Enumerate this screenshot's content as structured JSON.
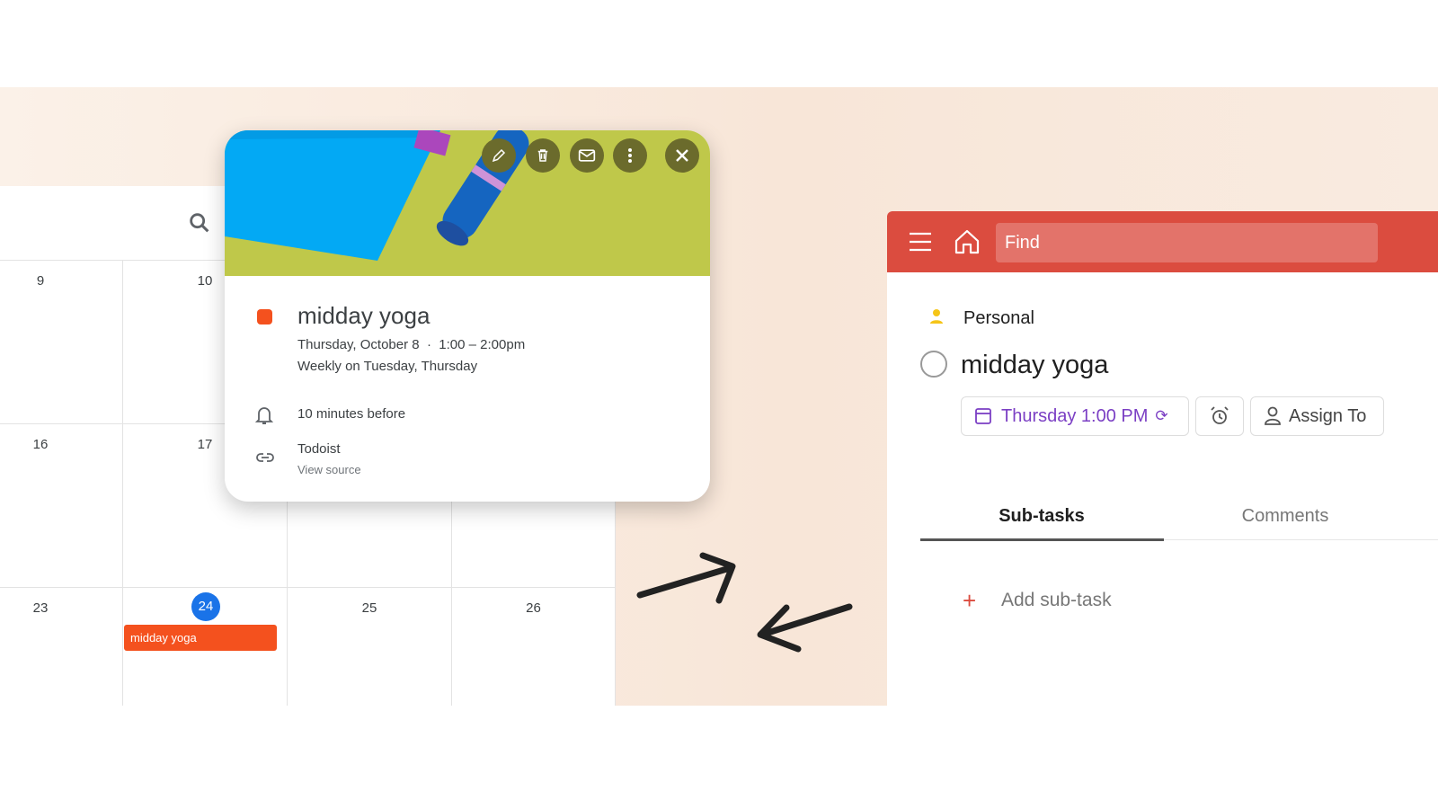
{
  "calendar": {
    "weeks": [
      [
        "9",
        "10",
        "",
        ""
      ],
      [
        "16",
        "17",
        "",
        ""
      ],
      [
        "23",
        "24",
        "25",
        "26"
      ]
    ],
    "today": "24",
    "event_chip": "midday yoga",
    "event_color": "#f4511e",
    "today_color": "#1a73e8"
  },
  "popup": {
    "title": "midday yoga",
    "datetime": "Thursday, October 8  ·  1:00 – 2:00pm",
    "recurrence": "Weekly on Tuesday, Thursday",
    "reminder": "10 minutes before",
    "source_name": "Todoist",
    "source_link": "View source",
    "toolbar": [
      "edit-icon",
      "delete-icon",
      "email-icon",
      "more-icon",
      "close-icon"
    ]
  },
  "todoist": {
    "search_placeholder": "Find",
    "project": "Personal",
    "task_title": "midday yoga",
    "due": "Thursday 1:00 PM",
    "assign": "Assign To",
    "tabs": [
      "Sub-tasks",
      "Comments"
    ],
    "add_subtask": "Add sub-task",
    "brand_color": "#db4c3f",
    "due_color": "#7b3fc4"
  }
}
